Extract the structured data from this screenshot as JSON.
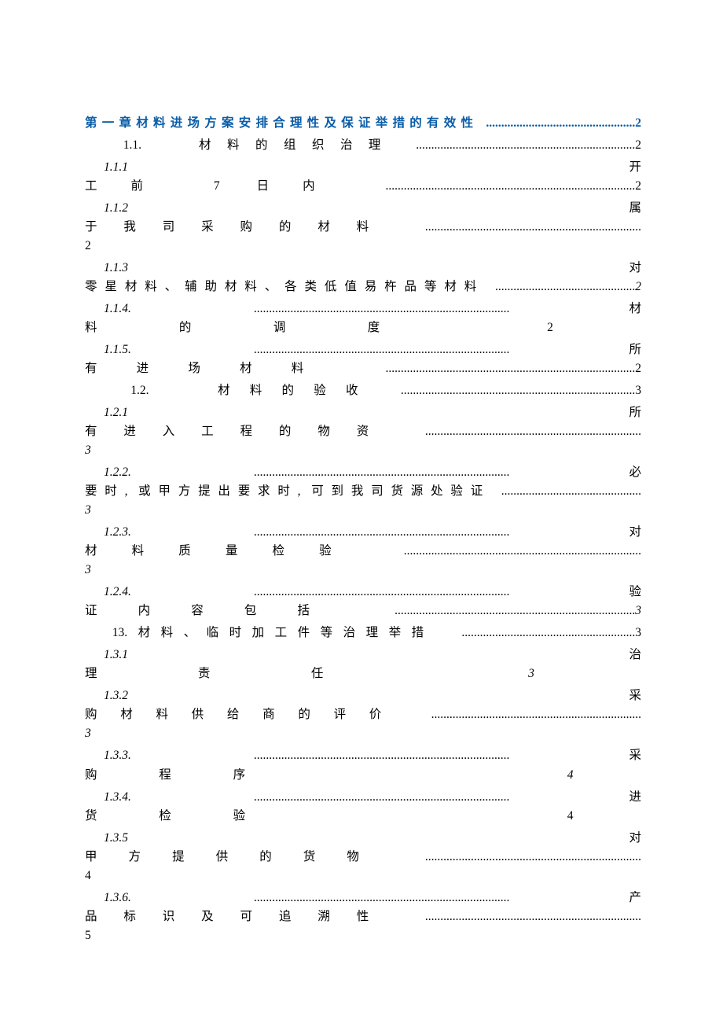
{
  "toc": {
    "chapter1": {
      "title_prefix": "第一章材料进场方案安排合理性及保证举措的有效性",
      "page": "2"
    },
    "s1_1": {
      "num": "1.1.",
      "title": "材料的组织治理",
      "page": "2"
    },
    "s1_1_1": {
      "num": "1.1.1",
      "suffix_char": "开",
      "cont": "工前 7 日内",
      "page": "2"
    },
    "s1_1_2": {
      "num": "1.1.2",
      "suffix_char": "属",
      "cont": "于我司采购的材料",
      "page": "2"
    },
    "s1_1_3": {
      "num": "1.1.3",
      "suffix_char": "对",
      "cont": "零星材料、辅助材料、各类低值易杵品等材料",
      "page": "2"
    },
    "s1_1_4": {
      "num": "1.1.4.",
      "suffix_char": "材",
      "cont": "料的调度",
      "page": "2"
    },
    "s1_1_5": {
      "num": "1.1.5.",
      "suffix_char": "所",
      "cont": "有进场材料",
      "page": "2"
    },
    "s1_2": {
      "num": "1.2.",
      "title": "材料的验收",
      "page": "3"
    },
    "s1_2_1": {
      "num": "1.2.1",
      "suffix_char": "所",
      "cont": "有进入工程的物资",
      "page": "3"
    },
    "s1_2_2": {
      "num": "1.2.2.",
      "suffix_char": "必",
      "cont": "要时, 或甲方提出要求时, 可到我司货源处验证",
      "page": "3"
    },
    "s1_2_3": {
      "num": "1.2.3.",
      "suffix_char": "对",
      "cont": "材料质量检验",
      "page": "3"
    },
    "s1_2_4": {
      "num": "1.2.4.",
      "suffix_char": "验",
      "cont": "证内容包括",
      "page": "3"
    },
    "s1_3": {
      "num": "13.",
      "title": "材料、临时加工件等治理举措",
      "page": "3"
    },
    "s1_3_1": {
      "num": "1.3.1",
      "suffix_char": "治",
      "cont": "理责任",
      "page": "3"
    },
    "s1_3_2": {
      "num": "1.3.2",
      "suffix_char": "采",
      "cont": "购材料供给商的评价",
      "page": "3"
    },
    "s1_3_3": {
      "num": "1.3.3.",
      "suffix_char": "采",
      "cont": "购程序",
      "page": "4"
    },
    "s1_3_4": {
      "num": "1.3.4.",
      "suffix_char": "进",
      "cont": "货检验",
      "page": "4"
    },
    "s1_3_5": {
      "num": "1.3.5",
      "suffix_char": "对",
      "cont": "甲方提供的货物",
      "page": "4"
    },
    "s1_3_6": {
      "num": "1.3.6.",
      "suffix_char": "产",
      "cont": "品标识及可追溯性",
      "page": "5"
    }
  }
}
